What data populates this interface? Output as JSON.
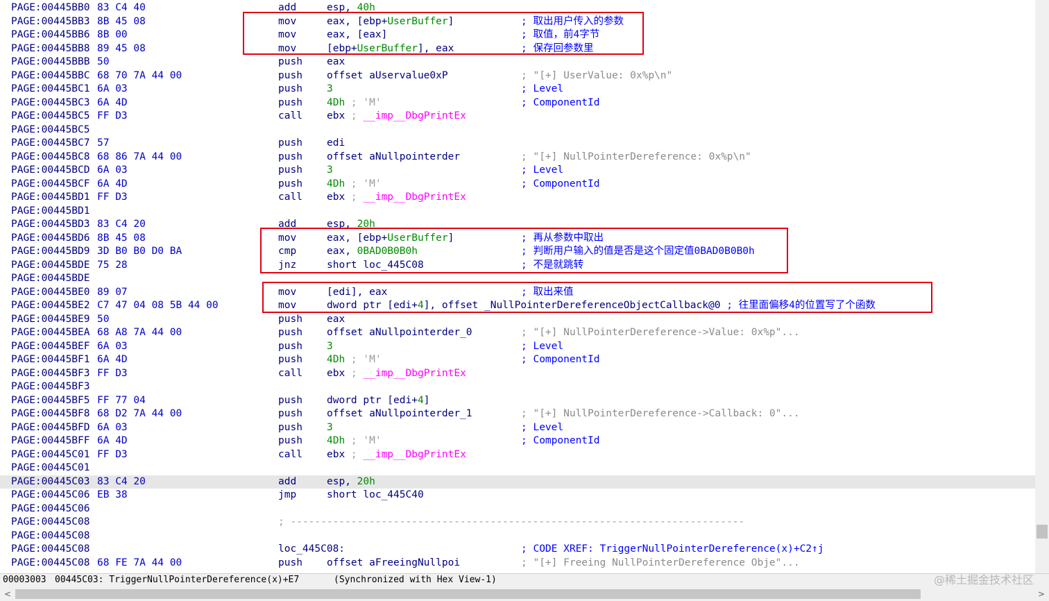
{
  "listing": [
    {
      "addr": "PAGE:00445BB0",
      "bytes": "83 C4 40",
      "mn": "add",
      "ops": [
        {
          "t": "esp, "
        },
        {
          "t": "40h",
          "c": "num"
        }
      ]
    },
    {
      "addr": "PAGE:00445BB3",
      "bytes": "8B 45 08",
      "mn": "mov",
      "ops": [
        {
          "t": "eax, [ebp+"
        },
        {
          "t": "UserBuffer",
          "c": "nm"
        },
        {
          "t": "]"
        }
      ],
      "cmt": [
        {
          "t": "; 取出用户传入的参数",
          "c": "cmt-blue"
        }
      ]
    },
    {
      "addr": "PAGE:00445BB6",
      "bytes": "8B 00",
      "mn": "mov",
      "ops": [
        {
          "t": "eax, [eax]"
        }
      ],
      "cmt": [
        {
          "t": "; 取值，前4字节",
          "c": "cmt-blue"
        }
      ]
    },
    {
      "addr": "PAGE:00445BB8",
      "bytes": "89 45 08",
      "mn": "mov",
      "ops": [
        {
          "t": "[ebp+"
        },
        {
          "t": "UserBuffer",
          "c": "nm"
        },
        {
          "t": "], eax"
        }
      ],
      "cmt": [
        {
          "t": "; 保存回参数里",
          "c": "cmt-blue"
        }
      ]
    },
    {
      "addr": "PAGE:00445BBB",
      "bytes": "50",
      "mn": "push",
      "ops": [
        {
          "t": "eax"
        }
      ]
    },
    {
      "addr": "PAGE:00445BBC",
      "bytes": "68 70 7A 44 00",
      "mn": "push",
      "ops": [
        {
          "t": "offset aUservalue0xP"
        }
      ],
      "cmt": [
        {
          "t": "; \"[+] UserValue: 0x%p\\n\""
        }
      ]
    },
    {
      "addr": "PAGE:00445BC1",
      "bytes": "6A 03",
      "mn": "push",
      "ops": [
        {
          "t": "3",
          "c": "num"
        }
      ],
      "cmt": [
        {
          "t": "; Level",
          "c": "cmt-blue"
        }
      ]
    },
    {
      "addr": "PAGE:00445BC3",
      "bytes": "6A 4D",
      "mn": "push",
      "ops": [
        {
          "t": "4Dh",
          "c": "num"
        },
        {
          "t": " ; 'M'",
          "c": "ch"
        }
      ],
      "cmt": [
        {
          "t": "; ComponentId",
          "c": "cmt-blue"
        }
      ]
    },
    {
      "addr": "PAGE:00445BC5",
      "bytes": "FF D3",
      "mn": "call",
      "ops": [
        {
          "t": "ebx "
        },
        {
          "t": "; ",
          "c": "ch"
        },
        {
          "t": "__imp__DbgPrintEx",
          "c": "imp"
        }
      ]
    },
    {
      "addr": "PAGE:00445BC5"
    },
    {
      "addr": "PAGE:00445BC7",
      "bytes": "57",
      "mn": "push",
      "ops": [
        {
          "t": "edi"
        }
      ]
    },
    {
      "addr": "PAGE:00445BC8",
      "bytes": "68 86 7A 44 00",
      "mn": "push",
      "ops": [
        {
          "t": "offset aNullpointerder"
        }
      ],
      "cmt": [
        {
          "t": "; \"[+] NullPointerDereference: 0x%p\\n\""
        }
      ]
    },
    {
      "addr": "PAGE:00445BCD",
      "bytes": "6A 03",
      "mn": "push",
      "ops": [
        {
          "t": "3",
          "c": "num"
        }
      ],
      "cmt": [
        {
          "t": "; Level",
          "c": "cmt-blue"
        }
      ]
    },
    {
      "addr": "PAGE:00445BCF",
      "bytes": "6A 4D",
      "mn": "push",
      "ops": [
        {
          "t": "4Dh",
          "c": "num"
        },
        {
          "t": " ; 'M'",
          "c": "ch"
        }
      ],
      "cmt": [
        {
          "t": "; ComponentId",
          "c": "cmt-blue"
        }
      ]
    },
    {
      "addr": "PAGE:00445BD1",
      "bytes": "FF D3",
      "mn": "call",
      "ops": [
        {
          "t": "ebx "
        },
        {
          "t": "; ",
          "c": "ch"
        },
        {
          "t": "__imp__DbgPrintEx",
          "c": "imp"
        }
      ]
    },
    {
      "addr": "PAGE:00445BD1"
    },
    {
      "addr": "PAGE:00445BD3",
      "bytes": "83 C4 20",
      "mn": "add",
      "ops": [
        {
          "t": "esp, "
        },
        {
          "t": "20h",
          "c": "num"
        }
      ]
    },
    {
      "addr": "PAGE:00445BD6",
      "bytes": "8B 45 08",
      "mn": "mov",
      "ops": [
        {
          "t": "eax, [ebp+"
        },
        {
          "t": "UserBuffer",
          "c": "nm"
        },
        {
          "t": "]"
        }
      ],
      "cmt": [
        {
          "t": "; 再从参数中取出",
          "c": "cmt-blue"
        }
      ]
    },
    {
      "addr": "PAGE:00445BD9",
      "bytes": "3D B0 B0 D0 BA",
      "mn": "cmp",
      "ops": [
        {
          "t": "eax, "
        },
        {
          "t": "0BAD0B0B0h",
          "c": "num"
        }
      ],
      "cmt": [
        {
          "t": "; 判断用户输入的值是否是这个固定值0BAD0B0B0h",
          "c": "cmt-blue"
        }
      ]
    },
    {
      "addr": "PAGE:00445BDE",
      "bytes": "75 28",
      "mn": "jnz",
      "ops": [
        {
          "t": "short loc_445C08"
        }
      ],
      "cmt": [
        {
          "t": "; 不是就跳转",
          "c": "cmt-blue"
        }
      ]
    },
    {
      "addr": "PAGE:00445BDE"
    },
    {
      "addr": "PAGE:00445BE0",
      "bytes": "89 07",
      "mn": "mov",
      "ops": [
        {
          "t": "[edi], eax"
        }
      ],
      "cmt": [
        {
          "t": "; 取出来值",
          "c": "cmt-blue"
        }
      ]
    },
    {
      "addr": "PAGE:00445BE2",
      "bytes": "C7 47 04 08 5B 44 00",
      "mn": "mov",
      "ops": [
        {
          "t": "dword ptr [edi+"
        },
        {
          "t": "4",
          "c": "num"
        },
        {
          "t": "], offset _NullPointerDereferenceObjectCallback@0 "
        },
        {
          "t": "; 往里面偏移4的位置写了个函数",
          "c": "cmt-blue"
        }
      ]
    },
    {
      "addr": "PAGE:00445BE9",
      "bytes": "50",
      "mn": "push",
      "ops": [
        {
          "t": "eax"
        }
      ]
    },
    {
      "addr": "PAGE:00445BEA",
      "bytes": "68 A8 7A 44 00",
      "mn": "push",
      "ops": [
        {
          "t": "offset aNullpointerder_0"
        }
      ],
      "cmt": [
        {
          "t": "; \"[+] NullPointerDereference->Value: 0x%p\"..."
        }
      ]
    },
    {
      "addr": "PAGE:00445BEF",
      "bytes": "6A 03",
      "mn": "push",
      "ops": [
        {
          "t": "3",
          "c": "num"
        }
      ],
      "cmt": [
        {
          "t": "; Level",
          "c": "cmt-blue"
        }
      ]
    },
    {
      "addr": "PAGE:00445BF1",
      "bytes": "6A 4D",
      "mn": "push",
      "ops": [
        {
          "t": "4Dh",
          "c": "num"
        },
        {
          "t": " ; 'M'",
          "c": "ch"
        }
      ],
      "cmt": [
        {
          "t": "; ComponentId",
          "c": "cmt-blue"
        }
      ]
    },
    {
      "addr": "PAGE:00445BF3",
      "bytes": "FF D3",
      "mn": "call",
      "ops": [
        {
          "t": "ebx "
        },
        {
          "t": "; ",
          "c": "ch"
        },
        {
          "t": "__imp__DbgPrintEx",
          "c": "imp"
        }
      ]
    },
    {
      "addr": "PAGE:00445BF3"
    },
    {
      "addr": "PAGE:00445BF5",
      "bytes": "FF 77 04",
      "mn": "push",
      "ops": [
        {
          "t": "dword ptr [edi+"
        },
        {
          "t": "4",
          "c": "num"
        },
        {
          "t": "]"
        }
      ]
    },
    {
      "addr": "PAGE:00445BF8",
      "bytes": "68 D2 7A 44 00",
      "mn": "push",
      "ops": [
        {
          "t": "offset aNullpointerder_1"
        }
      ],
      "cmt": [
        {
          "t": "; \"[+] NullPointerDereference->Callback: 0\"..."
        }
      ]
    },
    {
      "addr": "PAGE:00445BFD",
      "bytes": "6A 03",
      "mn": "push",
      "ops": [
        {
          "t": "3",
          "c": "num"
        }
      ],
      "cmt": [
        {
          "t": "; Level",
          "c": "cmt-blue"
        }
      ]
    },
    {
      "addr": "PAGE:00445BFF",
      "bytes": "6A 4D",
      "mn": "push",
      "ops": [
        {
          "t": "4Dh",
          "c": "num"
        },
        {
          "t": " ; 'M'",
          "c": "ch"
        }
      ],
      "cmt": [
        {
          "t": "; ComponentId",
          "c": "cmt-blue"
        }
      ]
    },
    {
      "addr": "PAGE:00445C01",
      "bytes": "FF D3",
      "mn": "call",
      "ops": [
        {
          "t": "ebx "
        },
        {
          "t": "; ",
          "c": "ch"
        },
        {
          "t": "__imp__DbgPrintEx",
          "c": "imp"
        }
      ]
    },
    {
      "addr": "PAGE:00445C01"
    },
    {
      "addr": "PAGE:00445C03",
      "bytes": "83 C4 20",
      "mn": "add",
      "ops": [
        {
          "t": "esp, "
        },
        {
          "t": "20h",
          "c": "num"
        }
      ],
      "selected": true
    },
    {
      "addr": "PAGE:00445C06",
      "bytes": "EB 38",
      "mn": "jmp",
      "ops": [
        {
          "t": "short loc_445C40"
        }
      ]
    },
    {
      "addr": "PAGE:00445C06"
    },
    {
      "addr": "PAGE:00445C08",
      "sep": "; ---------------------------------------------------------------------------"
    },
    {
      "addr": "PAGE:00445C08"
    },
    {
      "addr": "PAGE:00445C08",
      "label": "loc_445C08:",
      "cmt": [
        {
          "t": "; CODE XREF: TriggerNullPointerDereference(x)+C2↑j",
          "c": "cmt-blue"
        }
      ]
    },
    {
      "addr": "PAGE:00445C08",
      "bytes": "68 FE 7A 44 00",
      "mn": "push",
      "ops": [
        {
          "t": "offset aFreeingNullpoi"
        }
      ],
      "cmt": [
        {
          "t": "; \"[+] Freeing NullPointerDereference Obje\"..."
        }
      ]
    }
  ],
  "status": {
    "offset": "00003003",
    "location": "00445C03: TriggerNullPointerDereference(x)+E7",
    "sync": "(Synchronized with Hex View-1)"
  },
  "watermark": "@稀土掘金技术社区",
  "highlights": [
    "block-read-user-buffer",
    "block-compare-magic",
    "block-write-callback"
  ],
  "colors": {
    "address": "#000080",
    "bytes": "#0000c8",
    "number": "#008a00",
    "import": "#ff00ff",
    "comment": "#8a8a8a",
    "comment_user": "#0000ff",
    "highlight_box": "#e00010",
    "selected_line": "#e6e6e6"
  }
}
